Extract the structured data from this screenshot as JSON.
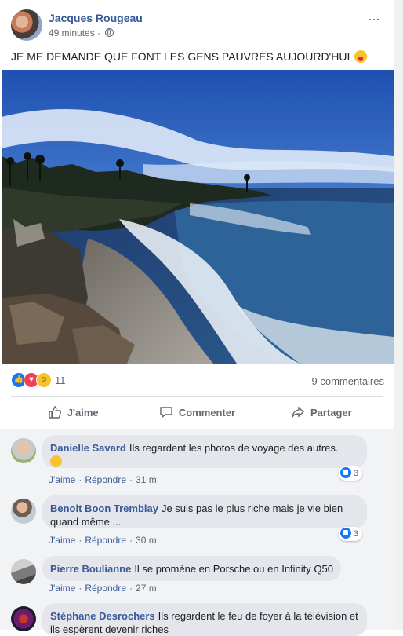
{
  "post": {
    "author": "Jacques Rougeau",
    "time": "49 minutes",
    "separator": "·",
    "more": "···",
    "text": "JE ME DEMANDE QUE FONT LES GENS PAUVRES AUJOURD'HUI",
    "text_emoji": "tongue-out-emoji"
  },
  "reactions": {
    "count": "11",
    "types": [
      "like",
      "love",
      "haha"
    ]
  },
  "comments_count": "9 commentaires",
  "actions": {
    "like": "J'aime",
    "comment": "Commenter",
    "share": "Partager"
  },
  "comments": [
    {
      "name": "Danielle Savard",
      "text": "Ils regardent les photos de voyage des autres.",
      "emoji": "thinking-face",
      "like": "J'aime",
      "reply": "Répondre",
      "time": "31 m",
      "reactions": "3"
    },
    {
      "name": "Benoit Boon Tremblay",
      "text": "Je suis pas le plus riche mais je vie bien quand même ...",
      "like": "J'aime",
      "reply": "Répondre",
      "time": "30 m",
      "reactions": "3"
    },
    {
      "name": "Pierre Boulianne",
      "text": "Il se promène en Porsche ou en Infinity Q50",
      "like": "J'aime",
      "reply": "Répondre",
      "time": "27 m"
    },
    {
      "name": "Stéphane Desrochers",
      "text": "Ils regardent le feu de foyer à la télévision et ils espèrent devenir riches"
    }
  ],
  "colors": {
    "link": "#385898",
    "like_blue": "#1877f2",
    "love_red": "#f33e58",
    "haha_yellow": "#f7c22a"
  }
}
